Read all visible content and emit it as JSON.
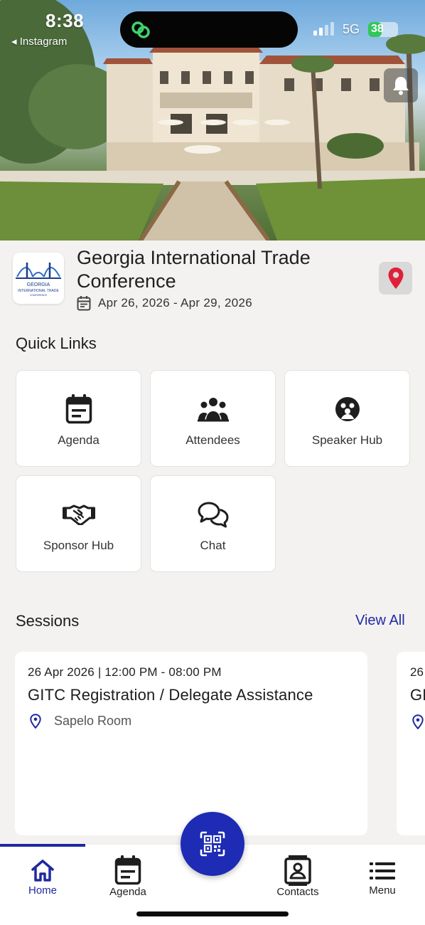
{
  "status_bar": {
    "time": "8:38",
    "back_app": "◂ Instagram",
    "network": "5G",
    "battery": "38",
    "battery_level": 0.38
  },
  "event": {
    "title": "Georgia International Trade Conference",
    "dates": "Apr 26, 2026 - Apr 29, 2026",
    "logo_text_line1": "GEORGIA",
    "logo_text_line2": "INTERNATIONAL TRADE",
    "logo_text_line3": "CONFERENCE"
  },
  "quick_links": {
    "title": "Quick Links",
    "items": [
      {
        "label": "Agenda",
        "icon": "calendar-icon"
      },
      {
        "label": "Attendees",
        "icon": "people-group-icon"
      },
      {
        "label": "Speaker Hub",
        "icon": "speaker-icon"
      },
      {
        "label": "Sponsor Hub",
        "icon": "handshake-icon"
      },
      {
        "label": "Chat",
        "icon": "chat-bubbles-icon"
      }
    ]
  },
  "sessions": {
    "title": "Sessions",
    "view_all": "View All",
    "items": [
      {
        "time": "26 Apr 2026 | 12:00 PM - 08:00 PM",
        "title": "GITC Registration / Delegate Assistance",
        "room": "Sapelo Room"
      },
      {
        "time": "26",
        "title": "GI"
      }
    ]
  },
  "bottom_nav": {
    "items": [
      {
        "label": "Home",
        "icon": "home-icon",
        "active": true
      },
      {
        "label": "Agenda",
        "icon": "calendar-icon",
        "active": false
      },
      {
        "label": "Contacts",
        "icon": "contact-card-icon",
        "active": false
      },
      {
        "label": "Menu",
        "icon": "menu-list-icon",
        "active": false
      }
    ],
    "center_action_icon": "qr-code-icon"
  },
  "colors": {
    "accent": "#1f2aa0",
    "fab": "#1e2bb4",
    "pin": "#e0203a",
    "battery": "#32c759"
  }
}
